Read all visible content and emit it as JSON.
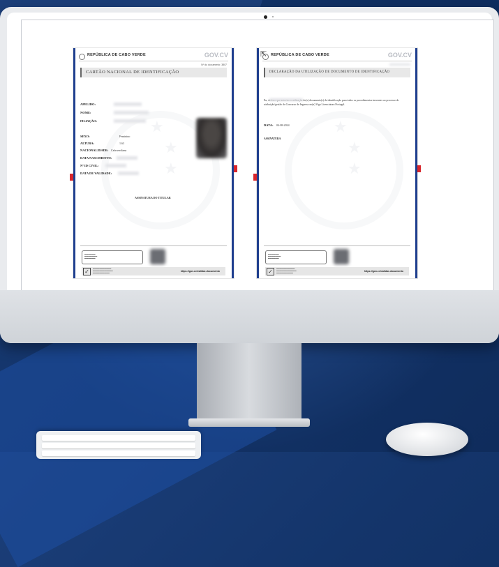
{
  "doc1": {
    "header": "REPÚBLICA DE CABO VERDE",
    "logo": "GOV.CV",
    "docnum": "Nº do documento: 3807",
    "title": "CARTÃO NACIONAL DE IDENTIFICAÇÃO",
    "fields": {
      "apelido": "APELIDO:",
      "nome": "NOME:",
      "filiacao": "FILIAÇÃO:",
      "sexo": "SEXO:",
      "sexo_val": "Feminino",
      "altura": "ALTURA:",
      "altura_val": "1.63",
      "nacionalidade": "NACIONALIDADE:",
      "nacionalidade_val": "Caboverdiana",
      "data_nascimento": "DATA NASCIMENTO:",
      "id_civil": "Nº ID CIVIL:",
      "data_validade": "DATA DE VALIDADE:"
    },
    "signature": "ASSINATURA DO TITULAR",
    "link": "https://gov.cv/validar-documento"
  },
  "doc2": {
    "header": "REPÚBLICA DE CABO VERDE",
    "logo": "GOV.CV",
    "title": "DECLARAÇÃO DA UTILIZAÇÃO DE DOCUMENTO DE IDENTIFICAÇÃO",
    "body": "Eu,                                    declaro que autorizo a utilização do(s) documento(s) de identificação para todos os procedimentos inerentes ao processo de atribuição/gestão do Concurso de Ingresso no(a) Viga Licenciatura Portugal.",
    "data_label": "DATA:",
    "data_val": "04-08-2024",
    "assinatura": "ASSINATURA",
    "link": "https://gov.cv/validar-documento"
  },
  "colors": {
    "accent_blue": "#1f3f8f",
    "accent_red": "#d8262c",
    "background": "#14356b"
  }
}
